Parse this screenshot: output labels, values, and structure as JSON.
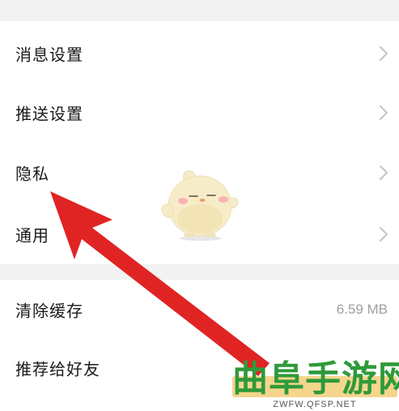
{
  "settings_group_1": {
    "items": [
      {
        "label": "消息设置",
        "icon": "chevron-right-icon"
      },
      {
        "label": "推送设置",
        "icon": "chevron-right-icon"
      },
      {
        "label": "隐私",
        "icon": "chevron-right-icon"
      },
      {
        "label": "通用",
        "icon": "chevron-right-icon"
      }
    ]
  },
  "settings_group_2": {
    "clear_cache": {
      "label": "清除缓存",
      "value": "6.59 MB"
    },
    "recommend": {
      "label": "推荐给好友"
    }
  },
  "overlay": {
    "mascot_icon": "mascot-icon",
    "arrow_icon": "red-arrow-icon",
    "arrow_color": "#e02424"
  },
  "watermark": {
    "title": "曲阜手游网",
    "url": "ZWFW.QFSP.NET",
    "title_color": "#2f9a3a",
    "band_color": "#f5d58c"
  }
}
